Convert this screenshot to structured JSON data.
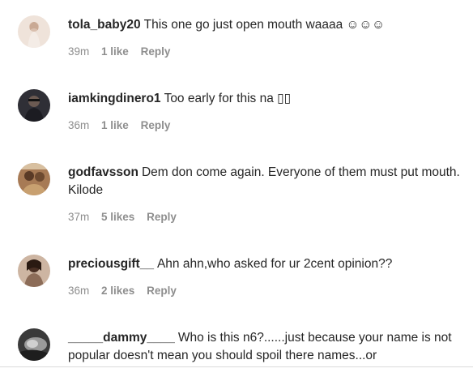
{
  "comments": [
    {
      "username": "tola_baby20",
      "text": "This one go just open mouth waaaa ☺☺☺",
      "time": "39m",
      "likes": "1 like",
      "reply": "Reply",
      "avatar_color": "#e6d4c8"
    },
    {
      "username": "iamkingdinero1",
      "text": "Too early for this na ▯▯",
      "time": "36m",
      "likes": "1 like",
      "reply": "Reply",
      "avatar_color": "#3b3b44"
    },
    {
      "username": "godfavsson",
      "text": "Dem don come again. Everyone of them must put mouth. Kilode",
      "time": "37m",
      "likes": "5 likes",
      "reply": "Reply",
      "avatar_color": "#8a5a3a"
    },
    {
      "username": "preciousgift__",
      "text": "Ahn ahn,who asked for ur 2cent opinion??",
      "time": "36m",
      "likes": "2 likes",
      "reply": "Reply",
      "avatar_color": "#b89a84"
    },
    {
      "username": "_____dammy____",
      "text": "Who is this n6?......just because your name is not popular doesn't mean you should spoil there names...or",
      "avatar_color": "#2e2e2e"
    }
  ]
}
